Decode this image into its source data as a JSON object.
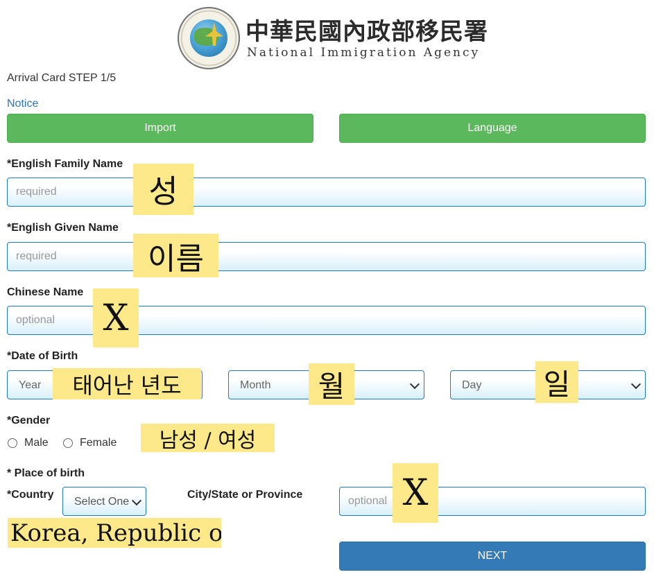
{
  "header": {
    "agency_chinese": "中華民國內政部移民署",
    "agency_english": "National Immigration Agency"
  },
  "page": {
    "step_title": "Arrival Card STEP 1/5",
    "notice_link": "Notice"
  },
  "buttons": {
    "import": "Import",
    "language": "Language",
    "next": "NEXT"
  },
  "form": {
    "family_name": {
      "label": "*English Family Name",
      "placeholder": "required",
      "value": ""
    },
    "given_name": {
      "label": "*English Given Name",
      "placeholder": "required",
      "value": ""
    },
    "chinese_name": {
      "label": "Chinese Name",
      "placeholder": "optional",
      "value": ""
    },
    "dob": {
      "label": "*Date of Birth",
      "year": "Year",
      "month": "Month",
      "day": "Day"
    },
    "gender": {
      "label": "*Gender",
      "options": [
        "Male",
        "Female"
      ]
    },
    "place_of_birth": {
      "label": "* Place of birth",
      "country_label": "*Country",
      "country_selected": "Select One",
      "city_label": "City/State or Province",
      "city_placeholder": "optional"
    }
  },
  "annotations": {
    "family_name": "성",
    "given_name": "이름",
    "chinese_name": "X",
    "year": "태어난 년도",
    "month": "월",
    "day": "일",
    "gender": "남성 / 여성",
    "city": "X",
    "country": "Korea, Republic of",
    "highlight_color": "#fde98a"
  },
  "colors": {
    "primary_green": "#5cb85c",
    "primary_blue": "#337ab7",
    "link_blue": "#2f74b5",
    "field_border": "#1f7bbf"
  }
}
